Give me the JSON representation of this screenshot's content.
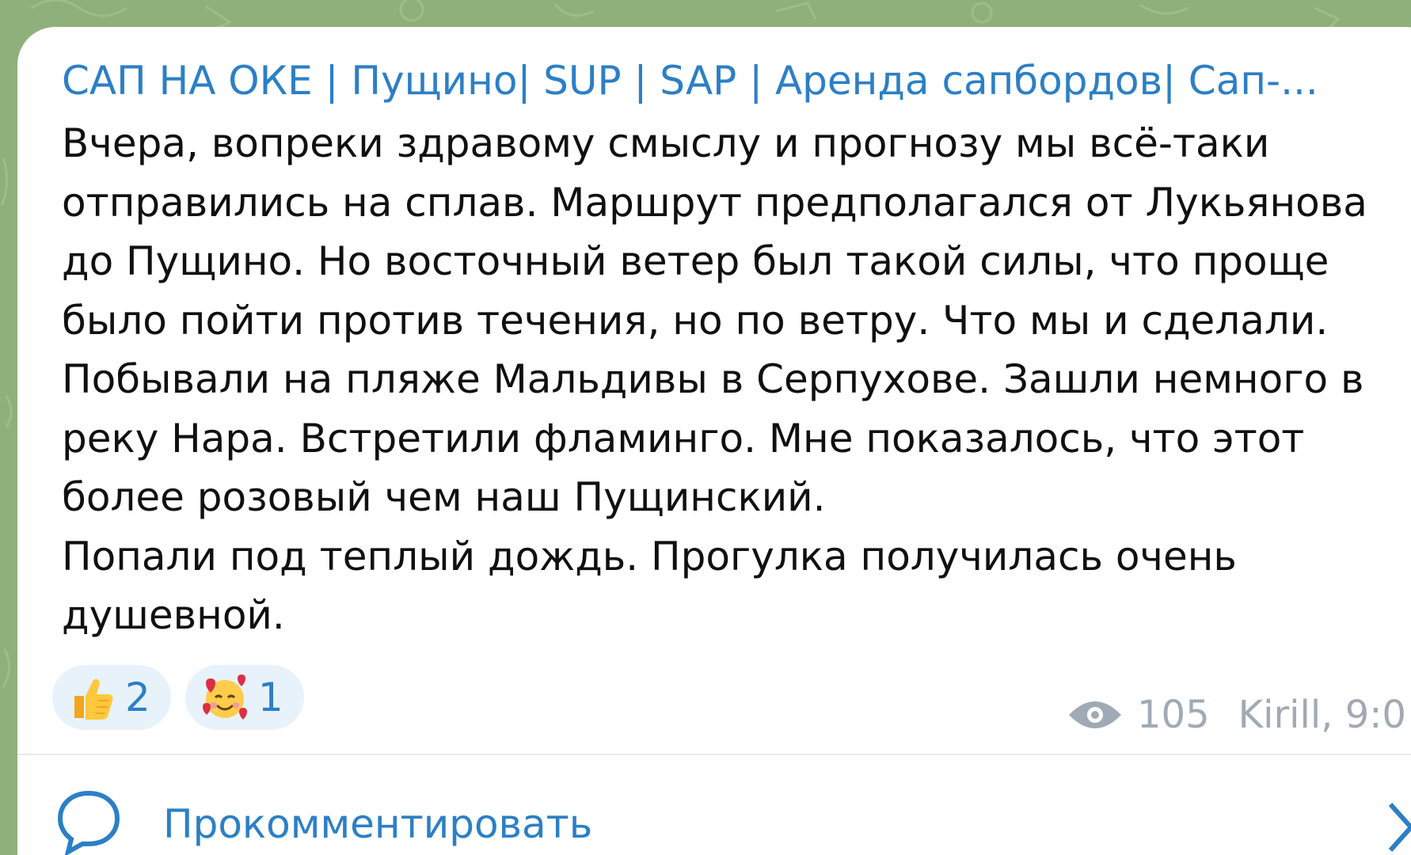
{
  "message": {
    "channel_name": "САП НА ОКЕ | Пущино| SUP | SAP | Аренда сапбордов| Сап-...",
    "text_lines": [
      "Вчера, вопреки здравому смыслу и прогнозу мы всё-таки",
      "отправились на сплав. Маршрут предполагался от Лукьянова",
      "до Пущино. Но восточный ветер был такой силы, что проще",
      "было пойти против течения, но по ветру. Что мы и сделали.",
      "Побывали на пляже Мальдивы в Серпухове. Зашли немного в",
      "реку Нара. Встретили фламинго. Мне показалось, что этот",
      "более розовый чем наш Пущинский.",
      "Попали под теплый дождь. Прогулка получилась очень",
      "душевной."
    ],
    "reactions": [
      {
        "emoji": "thumbs-up-icon",
        "count": "2"
      },
      {
        "emoji": "smiling-face-with-hearts-icon",
        "count": "1"
      }
    ],
    "views": "105",
    "author_time": "Kirill, 9:0"
  },
  "comments": {
    "label": "Прокомментировать"
  },
  "colors": {
    "background": "#8fb07a",
    "bubble": "#ffffff",
    "accent": "#2c7fc6",
    "meta": "#a0aab4"
  }
}
